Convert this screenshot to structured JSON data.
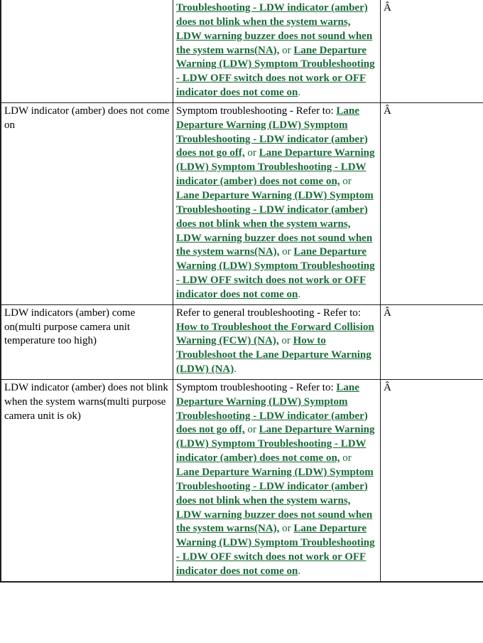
{
  "document": {
    "type": "service-manual-troubleshooting-table",
    "link_color": "#1a6b38",
    "text_color": "#000000",
    "border_color": "#231f20",
    "background_color": "#ffffff"
  },
  "table": {
    "columns": [
      "symptom",
      "action",
      "extra"
    ],
    "rows": [
      {
        "clipped_top": true,
        "symptom": "",
        "action_prefix": "",
        "action_segments": [
          {
            "kind": "link",
            "text": "Troubleshooting - LDW indicator (amber) does not blink when the system warns, LDW warning buzzer does not sound when the system warns(NA),"
          },
          {
            "kind": "sep",
            "text": " or "
          },
          {
            "kind": "link",
            "text": "Lane Departure Warning (LDW) Symptom Troubleshooting - LDW OFF switch does not work or OFF indicator does not come on"
          },
          {
            "kind": "period",
            "text": "."
          }
        ],
        "extra": "Â"
      },
      {
        "clipped_top": false,
        "symptom": "LDW indicator (amber) does not come on",
        "action_prefix": "Symptom troubleshooting - Refer to: ",
        "action_segments": [
          {
            "kind": "link",
            "text": "Lane Departure Warning (LDW) Symptom Troubleshooting - LDW indicator (amber) does not go off,"
          },
          {
            "kind": "sep",
            "text": " or "
          },
          {
            "kind": "link",
            "text": "Lane Departure Warning (LDW) Symptom Troubleshooting - LDW indicator (amber) does not come on,"
          },
          {
            "kind": "sep",
            "text": " or "
          },
          {
            "kind": "link",
            "text": "Lane Departure Warning (LDW) Symptom Troubleshooting - LDW indicator (amber) does not blink when the system warns, LDW warning buzzer does not sound when the system warns(NA),"
          },
          {
            "kind": "sep",
            "text": " or "
          },
          {
            "kind": "link",
            "text": "Lane Departure Warning (LDW) Symptom Troubleshooting - LDW OFF switch does not work or OFF indicator does not come on"
          },
          {
            "kind": "period",
            "text": "."
          }
        ],
        "extra": "Â"
      },
      {
        "clipped_top": false,
        "symptom": "LDW indicators (amber) come on(multi purpose camera unit temperature too high)",
        "action_prefix": "Refer to general troubleshooting - Refer to: ",
        "action_segments": [
          {
            "kind": "link",
            "text": "How to Troubleshoot the Forward Collision Warning (FCW) (NA),"
          },
          {
            "kind": "sep",
            "text": " or "
          },
          {
            "kind": "link",
            "text": "How to Troubleshoot the Lane Departure Warning (LDW) (NA)"
          },
          {
            "kind": "period",
            "text": "."
          }
        ],
        "extra": "Â"
      },
      {
        "clipped_top": false,
        "symptom": "LDW indicator (amber) does not blink when the system warns(multi purpose camera unit is ok)",
        "action_prefix": "Symptom troubleshooting - Refer to: ",
        "action_segments": [
          {
            "kind": "link",
            "text": "Lane Departure Warning (LDW) Symptom Troubleshooting - LDW indicator (amber) does not go off,"
          },
          {
            "kind": "sep",
            "text": " or "
          },
          {
            "kind": "link",
            "text": "Lane Departure Warning (LDW) Symptom Troubleshooting - LDW indicator (amber) does not come on,"
          },
          {
            "kind": "sep",
            "text": " or "
          },
          {
            "kind": "link",
            "text": "Lane Departure Warning (LDW) Symptom Troubleshooting - LDW indicator (amber) does not blink when the system warns, LDW warning buzzer does not sound when the system warns(NA),"
          },
          {
            "kind": "sep",
            "text": " or "
          },
          {
            "kind": "link",
            "text": "Lane Departure Warning (LDW) Symptom Troubleshooting - LDW OFF switch does not work or OFF indicator does not come on"
          },
          {
            "kind": "period",
            "text": "."
          }
        ],
        "extra": "Â"
      }
    ]
  }
}
